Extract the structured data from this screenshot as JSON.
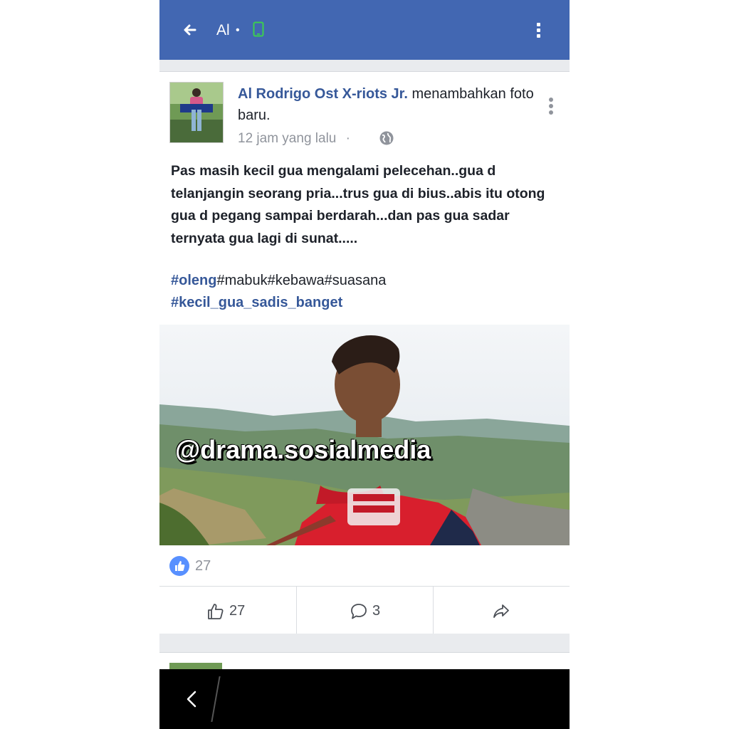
{
  "app": {
    "title": "Al",
    "dot": "•"
  },
  "post": {
    "author": "Al Rodrigo Ost X-riots Jr.",
    "action": " menambahkan foto baru.",
    "time": "12 jam yang lalu",
    "separator": "·",
    "body": "Pas masih kecil gua mengalami pelecehan..gua d telanjangin seorang pria...trus gua di bius..abis itu otong gua d pegang sampai berdarah...dan pas gua sadar ternyata gua lagi di sunat.....",
    "hashtags_line1": [
      {
        "text": "#oleng",
        "link": true
      },
      {
        "text": "#mabuk#kebawa#suasana",
        "link": false
      }
    ],
    "hashtag_line2": "#kecil_gua_sadis_banget",
    "watermark": "@drama.sosialmedia",
    "reaction_count": "27",
    "like_count": "27",
    "comment_count": "3"
  },
  "colors": {
    "header": "#4267b2",
    "link": "#365899",
    "like_badge": "#5890ff",
    "muted": "#90949c"
  },
  "icons": [
    "back-arrow-icon",
    "phone-icon",
    "more-vert-icon",
    "globe-icon",
    "like-badge-icon",
    "thumbs-up-icon",
    "comment-icon",
    "share-icon",
    "nav-back-icon"
  ]
}
